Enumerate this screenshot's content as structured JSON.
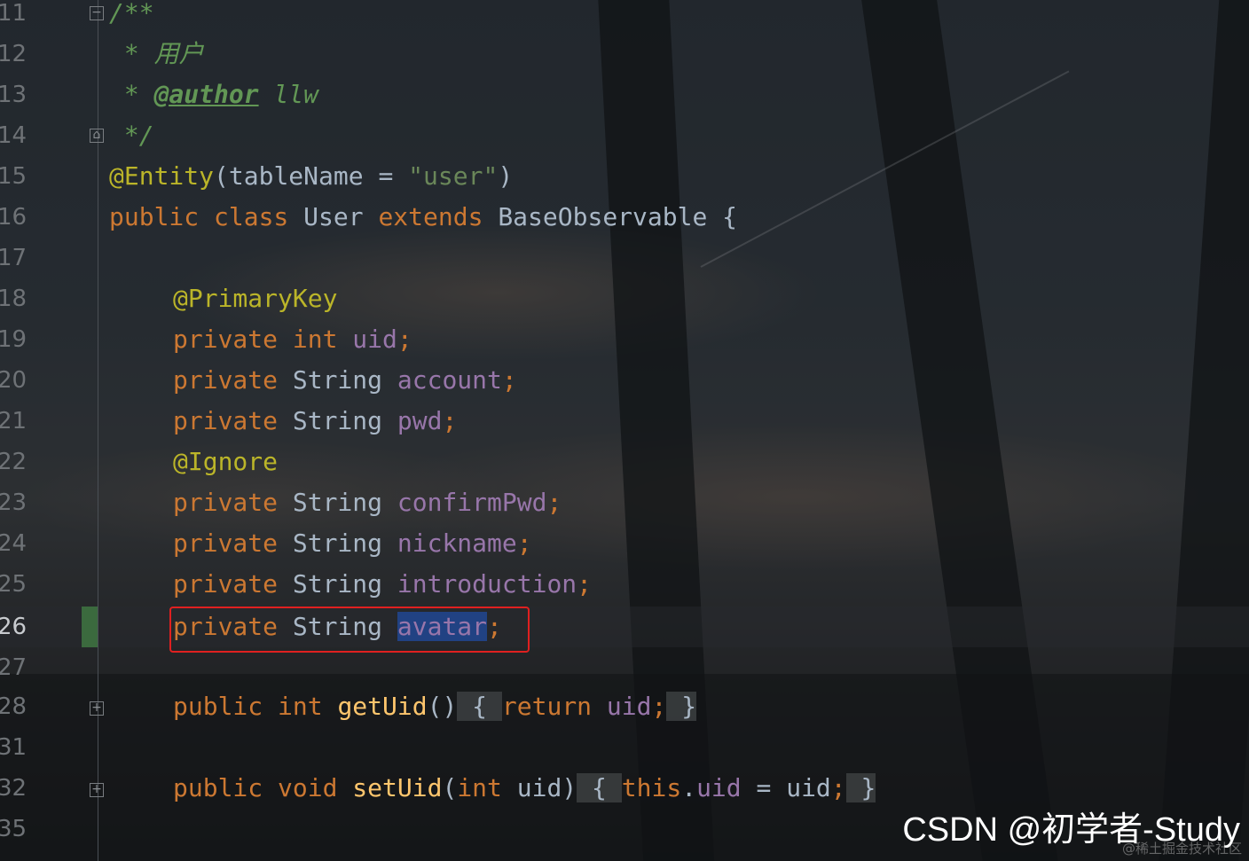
{
  "line_numbers": [
    "11",
    "12",
    "13",
    "14",
    "15",
    "16",
    "17",
    "18",
    "19",
    "20",
    "21",
    "22",
    "23",
    "24",
    "25",
    "26",
    "27",
    "28",
    "31",
    "32",
    "35"
  ],
  "code": {
    "l11": {
      "doc": "/**"
    },
    "l12": {
      "doc": " * 用户"
    },
    "l13": {
      "doc": " * ",
      "tag": "@author",
      "rest": " llw"
    },
    "l14": {
      "doc": " */"
    },
    "l15": {
      "ann": "@Entity",
      "p1": "(tableName = ",
      "str": "\"user\"",
      "p2": ")"
    },
    "l16": {
      "kw1": "public class ",
      "name": "User ",
      "kw2": "extends ",
      "base": "BaseObservable {"
    },
    "l18": {
      "ann": "@PrimaryKey"
    },
    "l19": {
      "kw": "private int ",
      "field": "uid",
      "semi": ";"
    },
    "l20": {
      "kw": "private ",
      "type": "String ",
      "field": "account",
      "semi": ";"
    },
    "l21": {
      "kw": "private ",
      "type": "String ",
      "field": "pwd",
      "semi": ";"
    },
    "l22": {
      "ann": "@Ignore"
    },
    "l23": {
      "kw": "private ",
      "type": "String ",
      "field": "confirmPwd",
      "semi": ";"
    },
    "l24": {
      "kw": "private ",
      "type": "String ",
      "field": "nickname",
      "semi": ";"
    },
    "l25": {
      "kw": "private ",
      "type": "String ",
      "field": "introduction",
      "semi": ";"
    },
    "l26": {
      "kw": "private ",
      "type": "String ",
      "field": "avatar",
      "semi": ";"
    },
    "l28": {
      "kw": "public int ",
      "meth": "getUid",
      "paren": "()",
      "ob": " { ",
      "ret": "return ",
      "field": "uid",
      "semi": ";",
      "cb": " }"
    },
    "l32": {
      "kw": "public void ",
      "meth": "setUid",
      "p1": "(",
      "kw2": "int ",
      "arg": "uid)",
      "ob": " { ",
      "this": "this",
      "dot": ".",
      "field": "uid",
      "eq": " = uid",
      "semi": ";",
      "cb": " }"
    }
  },
  "watermark": "CSDN @初学者-Study",
  "watermark_small": "@稀土掘金技术社区"
}
